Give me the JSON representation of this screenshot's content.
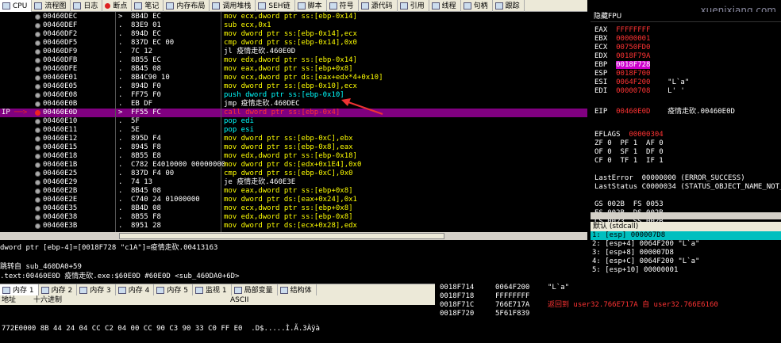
{
  "watermark": "xuenixiang.com",
  "tabs": [
    "CPU",
    "流程图",
    "日志",
    "断点",
    "笔记",
    "内存布局",
    "调用堆栈",
    "SEH链",
    "脚本",
    "符号",
    "源代码",
    "引用",
    "线程",
    "句柄",
    "跟踪"
  ],
  "disasm": [
    {
      "addr": "00460DEC",
      "arr": ">",
      "hex": "8B4D EC",
      "asm": "mov ecx,dword ptr ss:[ebp-0x14]"
    },
    {
      "addr": "00460DEF",
      "arr": ".",
      "hex": "83E9 01",
      "asm": "sub ecx,0x1"
    },
    {
      "addr": "00460DF2",
      "arr": ".",
      "hex": "894D EC",
      "asm": "mov dword ptr ss:[ebp-0x14],ecx"
    },
    {
      "addr": "00460DF5",
      "arr": ".",
      "hex": "837D EC 00",
      "asm": "cmp dword ptr ss:[ebp-0x14],0x0"
    },
    {
      "addr": "00460DF9",
      "arr": ".",
      "hex": "7C 12",
      "asm": "jl 疫情走砍.460E0D"
    },
    {
      "addr": "00460DFB",
      "arr": ".",
      "hex": "8B55 EC",
      "asm": "mov edx,dword ptr ss:[ebp-0x14]"
    },
    {
      "addr": "00460DFE",
      "arr": ".",
      "hex": "8B45 08",
      "asm": "mov eax,dword ptr ss:[ebp+0x8]"
    },
    {
      "addr": "00460E01",
      "arr": ".",
      "hex": "8B4C90 10",
      "asm": "mov ecx,dword ptr ds:[eax+edx*4+0x10]"
    },
    {
      "addr": "00460E05",
      "arr": ".",
      "hex": "894D F0",
      "asm": "mov dword ptr ss:[ebp-0x10],ecx"
    },
    {
      "addr": "00460E08",
      "arr": ".",
      "hex": "FF75 F0",
      "asm": "push dword ptr ss:[ebp-0x10]"
    },
    {
      "addr": "00460E0B",
      "arr": ".",
      "hex": "EB DF",
      "asm": "jmp 疫情走砍.460DEC"
    },
    {
      "addr": "00460E0D",
      "arr": ">",
      "hex": "FF55 FC",
      "asm": "call dword ptr ss:[ebp-0x4]"
    },
    {
      "addr": "00460E10",
      "arr": ".",
      "hex": "5F",
      "asm": "pop edi"
    },
    {
      "addr": "00460E11",
      "arr": ".",
      "hex": "5E",
      "asm": "pop esi"
    },
    {
      "addr": "00460E12",
      "arr": ".",
      "hex": "895D F4",
      "asm": "mov dword ptr ss:[ebp-0xC],ebx"
    },
    {
      "addr": "00460E15",
      "arr": ".",
      "hex": "8945 F8",
      "asm": "mov dword ptr ss:[ebp-0x8],eax"
    },
    {
      "addr": "00460E18",
      "arr": ".",
      "hex": "8B55 E8",
      "asm": "mov edx,dword ptr ss:[ebp-0x18]"
    },
    {
      "addr": "00460E1B",
      "arr": ".",
      "hex": "C782 E4010000 00000000",
      "asm": "mov dword ptr ds:[edx+0x1E4],0x0"
    },
    {
      "addr": "00460E25",
      "arr": ".",
      "hex": "837D F4 00",
      "asm": "cmp dword ptr ss:[ebp-0xC],0x0"
    },
    {
      "addr": "00460E29",
      "arr": ".",
      "hex": "74 13",
      "asm": "je 疫情走砍.460E3E"
    },
    {
      "addr": "00460E2B",
      "arr": ".",
      "hex": "8B45 08",
      "asm": "mov eax,dword ptr ss:[ebp+0x8]"
    },
    {
      "addr": "00460E2E",
      "arr": ".",
      "hex": "C740 24 01000000",
      "asm": "mov dword ptr ds:[eax+0x24],0x1"
    },
    {
      "addr": "00460E35",
      "arr": ".",
      "hex": "8B4D 08",
      "asm": "mov ecx,dword ptr ss:[ebp+0x8]"
    },
    {
      "addr": "00460E38",
      "arr": ".",
      "hex": "8B55 F8",
      "asm": "mov edx,dword ptr ss:[ebp-0x8]"
    },
    {
      "addr": "00460E3B",
      "arr": ".",
      "hex": "8951 28",
      "asm": "mov dword ptr ds:[ecx+0x28],edx"
    }
  ],
  "ip_label": "IP",
  "info": [
    "dword ptr [ebp-4]=[0018F728 \"c1A\"]=疫情走砍.00413163",
    "",
    "跳转自 sub_460DA0+59",
    ".text:00460E0D 疫情走砍.exe:$60E0D #60E0D <sub_460DA0+6D>"
  ],
  "reg_title": "隐藏FPU",
  "regs": [
    {
      "n": "EAX",
      "v": "FFFFFFFF",
      "c": ""
    },
    {
      "n": "EBX",
      "v": "00000001",
      "c": ""
    },
    {
      "n": "ECX",
      "v": "00750FD0",
      "c": ""
    },
    {
      "n": "EDX",
      "v": "0018F79A",
      "c": ""
    },
    {
      "n": "EBP",
      "v": "0018F728",
      "c": ""
    },
    {
      "n": "ESP",
      "v": "0018F700",
      "c": ""
    },
    {
      "n": "ESI",
      "v": "0064F200",
      "c": "\"L`a\""
    },
    {
      "n": "EDI",
      "v": "00000708",
      "c": "L' '"
    }
  ],
  "eip": {
    "n": "EIP",
    "v": "00460E0D",
    "c": "疫情走砍.00460E0D"
  },
  "eflags": {
    "n": "EFLAGS",
    "v": "00000304"
  },
  "flags1": "ZF 0  PF 1  AF 0",
  "flags2": "OF 0  SF 1  DF 0",
  "flags3": "CF 0  TF 1  IF 1",
  "lasterror": "LastError  00000000 (ERROR_SUCCESS)",
  "laststatus": "LastStatus C0000034 (STATUS_OBJECT_NAME_NOT_F",
  "segs1": "GS 002B  FS 0053",
  "segs2": "ES 002B  DS 002B",
  "segs3": "CS 0023  SS 002B",
  "stack_hdr": "默认 (stdcall)",
  "stack_args": [
    "1: [esp] 000007D8",
    "2: [esp+4] 0064F200 \"L`a\"",
    "3: [esp+8] 000007D8",
    "4: [esp+C] 0064F200 \"L`a\"",
    "5: [esp+10] 00000001"
  ],
  "btabs": [
    "内存 1",
    "内存 2",
    "内存 3",
    "内存 4",
    "内存 5",
    "监视 1",
    "局部变量",
    "结构体"
  ],
  "dump_hdr": {
    "addr": "地址",
    "hex": "十六进制",
    "ascii": "ASCII"
  },
  "dump_row": "772E0000 8B 44 24 04 CC C2 04 00 CC 90 C3 90 33 C0 FF E0  .D$.....Ì.Ã.3Àÿà",
  "bstack": [
    {
      "a": "0018F714",
      "v": "0064F200",
      "c": "\"L`a\""
    },
    {
      "a": "0018F718",
      "v": "FFFFFFFF",
      "c": ""
    },
    {
      "a": "0018F71C",
      "v": "766E717A",
      "c": "返回到 user32.766E717A 自 user32.766E6160"
    },
    {
      "a": "0018F720",
      "v": "5F61F839",
      "c": ""
    }
  ],
  "colors": {
    "accent": "#800080",
    "highlight": "#ffff00",
    "red": "#ff3333",
    "cyan": "#00bfbf"
  }
}
